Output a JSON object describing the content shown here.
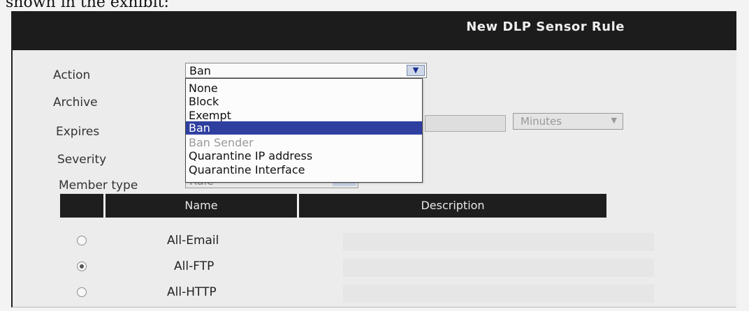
{
  "top_caption": "shown in the exhibit:",
  "dialog": {
    "title": "New DLP Sensor Rule"
  },
  "form": {
    "action_label": "Action",
    "archive_label": "Archive",
    "expires_label": "Expires",
    "severity_label": "Severity",
    "member_type_label": "Member type",
    "action_value": "Ban",
    "member_type_value": "Rule",
    "expires_unit": "Minutes"
  },
  "action_dropdown": {
    "options": [
      {
        "label": "None",
        "state": "normal"
      },
      {
        "label": "Block",
        "state": "normal"
      },
      {
        "label": "Exempt",
        "state": "normal"
      },
      {
        "label": "Ban",
        "state": "selected"
      },
      {
        "label": "Ban Sender",
        "state": "disabled"
      },
      {
        "label": "Quarantine IP address",
        "state": "normal"
      },
      {
        "label": "Quarantine Interface",
        "state": "normal"
      }
    ]
  },
  "table": {
    "headers": {
      "name": "Name",
      "description": "Description"
    },
    "rows": [
      {
        "name": "All-Email",
        "description": "",
        "checked": false
      },
      {
        "name": "All-FTP",
        "description": "",
        "checked": true
      },
      {
        "name": "All-HTTP",
        "description": "",
        "checked": false
      }
    ]
  },
  "colors": {
    "title_bar": "#1c1c1c",
    "selected_option": "#2f3fa0",
    "table_header": "#1e1e1e"
  }
}
